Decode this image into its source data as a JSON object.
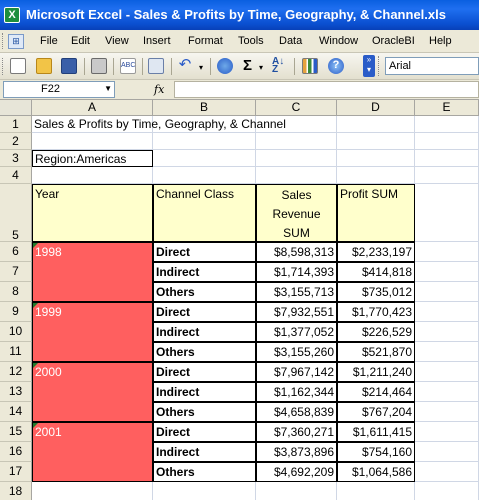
{
  "window": {
    "title": "Microsoft Excel - Sales & Profits by Time, Geography, & Channel.xls",
    "app_icon": "excel-icon"
  },
  "menu": [
    "File",
    "Edit",
    "View",
    "Insert",
    "Format",
    "Tools",
    "Data",
    "Window",
    "OracleBI",
    "Help"
  ],
  "toolbar": {
    "icons": [
      "new-icon",
      "open-icon",
      "save-icon",
      "print-icon",
      "spelling-icon",
      "copy-icon",
      "undo-icon",
      "hyperlink-icon",
      "autosum-icon",
      "sort-ascending-icon",
      "chart-wizard-icon",
      "help-icon"
    ],
    "font": "Arial",
    "sigma": "Σ"
  },
  "formula_bar": {
    "name_box": "F22",
    "fx": "fx",
    "value": ""
  },
  "columns": [
    "A",
    "B",
    "C",
    "D",
    "E"
  ],
  "rows": [
    "1",
    "2",
    "3",
    "4",
    "5",
    "6",
    "7",
    "8",
    "9",
    "10",
    "11",
    "12",
    "13",
    "14",
    "15",
    "16",
    "17",
    "18"
  ],
  "sheet": {
    "title": "Sales & Profits by Time, Geography, & Channel",
    "region": "Region:Americas",
    "headers": {
      "year": "Year",
      "channel": "Channel Class",
      "sales_l1": "Sales",
      "sales_l2": "Revenue",
      "sales_l3": "SUM",
      "profit": "Profit SUM"
    },
    "groups": [
      {
        "year": "1998",
        "rows": [
          {
            "channel": "Direct",
            "sales": "$8,598,313",
            "profit": "$2,233,197"
          },
          {
            "channel": "Indirect",
            "sales": "$1,714,393",
            "profit": "$414,818"
          },
          {
            "channel": "Others",
            "sales": "$3,155,713",
            "profit": "$735,012"
          }
        ]
      },
      {
        "year": "1999",
        "rows": [
          {
            "channel": "Direct",
            "sales": "$7,932,551",
            "profit": "$1,770,423"
          },
          {
            "channel": "Indirect",
            "sales": "$1,377,052",
            "profit": "$226,529"
          },
          {
            "channel": "Others",
            "sales": "$3,155,260",
            "profit": "$521,870"
          }
        ]
      },
      {
        "year": "2000",
        "rows": [
          {
            "channel": "Direct",
            "sales": "$7,967,142",
            "profit": "$1,211,240"
          },
          {
            "channel": "Indirect",
            "sales": "$1,162,344",
            "profit": "$214,464"
          },
          {
            "channel": "Others",
            "sales": "$4,658,839",
            "profit": "$767,204"
          }
        ]
      },
      {
        "year": "2001",
        "rows": [
          {
            "channel": "Direct",
            "sales": "$7,360,271",
            "profit": "$1,611,415"
          },
          {
            "channel": "Indirect",
            "sales": "$3,873,896",
            "profit": "$754,160"
          },
          {
            "channel": "Others",
            "sales": "$4,692,209",
            "profit": "$1,064,586"
          }
        ]
      }
    ]
  },
  "colors": {
    "year_fill": "#ff5f5f",
    "title_bar": "#0a5fe0"
  }
}
